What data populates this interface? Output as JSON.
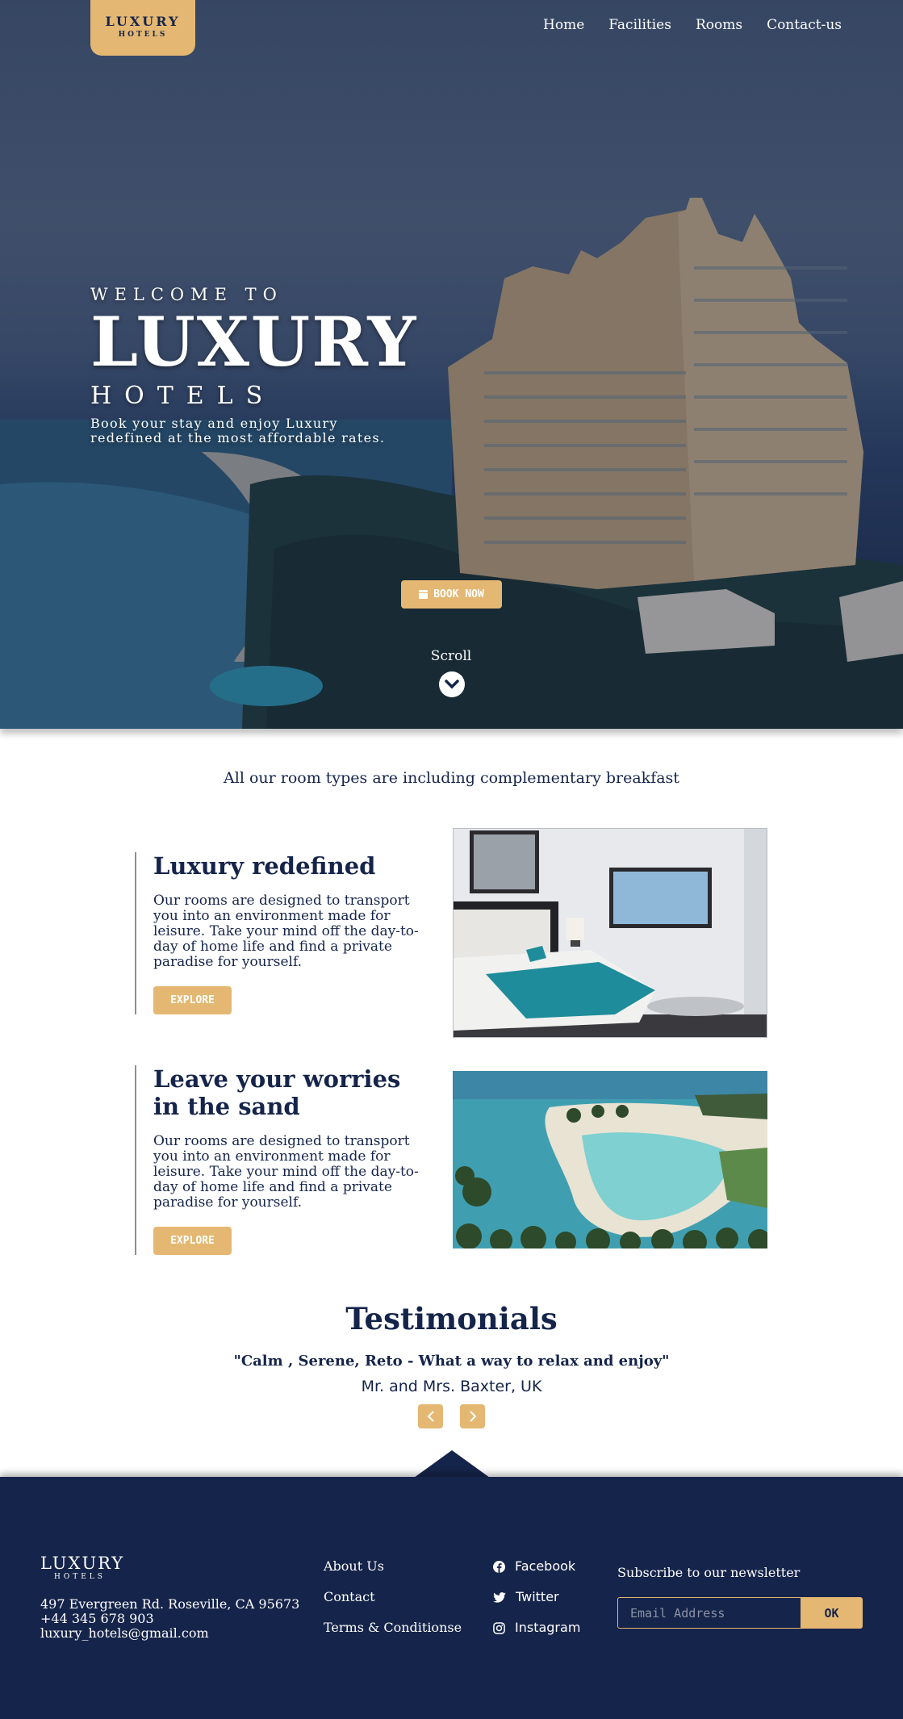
{
  "brand": {
    "name": "LUXURY",
    "sub": "HOTELS"
  },
  "nav": {
    "items": [
      "Home",
      "Facilities",
      "Rooms",
      "Contact-us"
    ]
  },
  "hero": {
    "welcome": "WELCOME TO",
    "title": "LUXURY",
    "subtitle": "HOTELS",
    "description": "Book your stay and enjoy Luxury redefined at the most affordable rates.",
    "book_label": "BOOK NOW",
    "scroll_label": "Scroll"
  },
  "rooms": {
    "breakfast_note": "All our room types are including complementary breakfast",
    "features": [
      {
        "title": "Luxury redefined",
        "text": "Our rooms are designed to transport you into an environment made for leisure. Take your mind off the day-to-day of home life and find a private paradise for yourself.",
        "button": "EXPLORE"
      },
      {
        "title": "Leave your worries in the sand",
        "text": "Our rooms are designed to transport you into an environment made for leisure. Take your mind off the day-to-day of home life and find a private paradise for yourself.",
        "button": "EXPLORE"
      }
    ]
  },
  "testimonials": {
    "title": "Testimonials",
    "quote": "\"Calm , Serene, Reto - What a way to relax and enjoy\"",
    "author": "Mr. and Mrs. Baxter, UK"
  },
  "footer": {
    "logo": "LUXURY",
    "logo_sub": "HOTELS",
    "address": "497 Evergreen Rd. Roseville, CA 95673",
    "phone": "+44 345 678 903",
    "email": "luxury_hotels@gmail.com",
    "links": [
      "About Us",
      "Contact",
      "Terms & Conditionse"
    ],
    "social": [
      {
        "label": "Facebook",
        "icon": "facebook-icon"
      },
      {
        "label": "Twitter",
        "icon": "twitter-icon"
      },
      {
        "label": "Instagram",
        "icon": "instagram-icon"
      }
    ],
    "newsletter_title": "Subscribe to our newsletter",
    "email_placeholder": "Email Address",
    "ok_label": "OK"
  },
  "colors": {
    "navy": "#15244a",
    "gold": "#e4b872"
  }
}
